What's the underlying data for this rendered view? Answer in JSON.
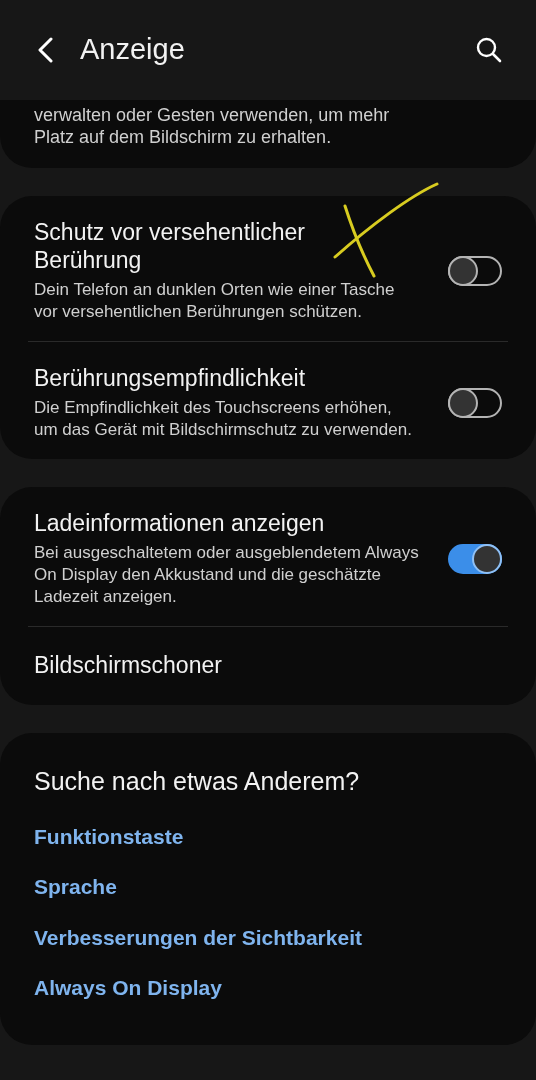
{
  "header": {
    "title": "Anzeige"
  },
  "partial_section": {
    "description": "verwalten oder Gesten verwenden, um mehr Platz auf dem Bildschirm zu erhalten."
  },
  "sections": [
    {
      "items": [
        {
          "kind": "toggle",
          "title": "Schutz vor versehentlicher Berührung",
          "description": "Dein Telefon an dunklen Orten wie einer Tasche vor versehentlichen Berührungen schützen.",
          "on": false
        },
        {
          "kind": "toggle",
          "title": "Berührungsempfindlichkeit",
          "description": "Die Empfindlichkeit des Touchscreens erhöhen, um das Gerät mit Bildschirmschutz zu verwenden.",
          "on": false
        }
      ]
    },
    {
      "items": [
        {
          "kind": "toggle",
          "title": "Ladeinformationen anzeigen",
          "description": "Bei ausgeschaltetem oder ausgeblendetem Always On Display den Akkustand und die geschätzte Ladezeit anzeigen.",
          "on": true
        },
        {
          "kind": "plain",
          "title": "Bildschirmschoner"
        }
      ]
    }
  ],
  "suggestions": {
    "title": "Suche nach etwas Anderem?",
    "links": [
      "Funktionstaste",
      "Sprache",
      "Verbesserungen der Sichtbarkeit",
      "Always On Display"
    ]
  }
}
